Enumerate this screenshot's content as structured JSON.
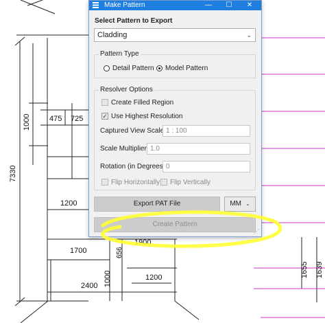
{
  "window": {
    "title": "Make Pattern"
  },
  "controls": {
    "minimize": "—",
    "maximize": "☐",
    "close": "✕"
  },
  "export_section": {
    "label": "Select Pattern to Export",
    "selected": "Cladding"
  },
  "pattern_type": {
    "legend": "Pattern Type",
    "options": [
      {
        "label": "Detail Pattern",
        "checked": false
      },
      {
        "label": "Model Pattern",
        "checked": true
      }
    ]
  },
  "resolver": {
    "legend": "Resolver Options",
    "create_filled_region": "Create Filled Region",
    "use_highest_resolution": "Use Highest Resolution",
    "captured_view_scale_label": "Captured View Scale",
    "captured_view_scale_value": "1 : 100",
    "scale_multiplier_label": "Scale Multiplier",
    "scale_multiplier_value": "1.0",
    "rotation_label": "Rotation (in Degrees)",
    "rotation_value": "0",
    "flip_horizontally": "Flip Horizontally",
    "flip_vertically": "Flip Vertically"
  },
  "buttons": {
    "export_pat": "Export PAT File",
    "units": "MM",
    "create_pattern": "Create Pattern"
  },
  "drawing": {
    "dims": [
      "7330",
      "1000",
      "475",
      "725",
      "1200",
      "1700",
      "656",
      "1900",
      "2400",
      "1000",
      "1200",
      "1655",
      "1639"
    ]
  },
  "colors": {
    "titlebar": "#1f7fe0",
    "highlight": "#ffff33",
    "magenta_line": "#cc33cc"
  }
}
